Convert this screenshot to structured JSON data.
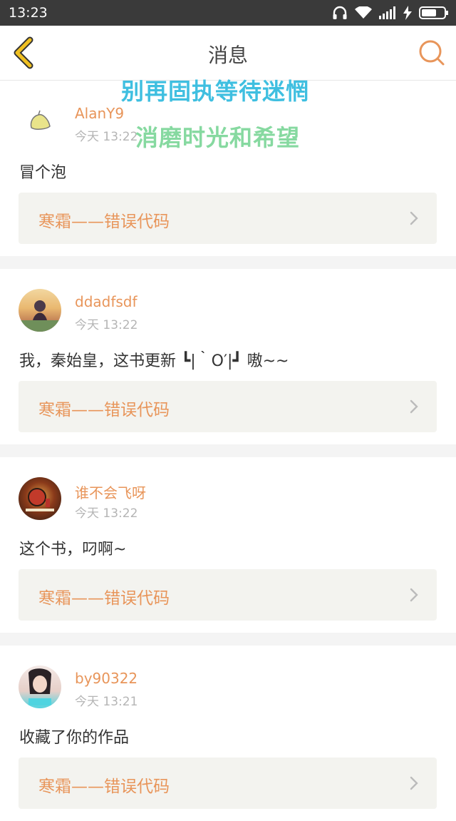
{
  "status_bar": {
    "time": "13:23",
    "icons": [
      "headphones-icon",
      "wifi-icon",
      "signal-icon",
      "charging-icon",
      "battery-icon"
    ]
  },
  "header": {
    "title": "消息",
    "back_icon": "chevron-left-icon",
    "search_icon": "search-icon"
  },
  "overlay": {
    "line1": "别再固执等待迷惘",
    "line2": "消磨时光和希望"
  },
  "messages": [
    {
      "username": "AlanY9",
      "time": "今天 13:22",
      "text": "冒个泡",
      "link": "寒霜——错误代码",
      "avatar": "avatar-plant"
    },
    {
      "username": "ddadfsdf",
      "time": "今天 13:22",
      "text": "我，秦始皇，这书更新 ┗|｀O′|┛ 嗷~~",
      "link": "寒霜——错误代码",
      "avatar": "avatar-sunset"
    },
    {
      "username": "谁不会飞呀",
      "time": "今天 13:22",
      "text": "这个书，叼啊~",
      "link": "寒霜——错误代码",
      "avatar": "avatar-lamp"
    },
    {
      "username": "by90322",
      "time": "今天 13:21",
      "text": "收藏了你的作品",
      "link": "寒霜——错误代码",
      "avatar": "avatar-portrait"
    }
  ],
  "colors": {
    "accent": "#e8955a",
    "back_arrow": "#f0c020",
    "overlay1": "#3fbfe0",
    "overlay2": "#86d9a0"
  }
}
